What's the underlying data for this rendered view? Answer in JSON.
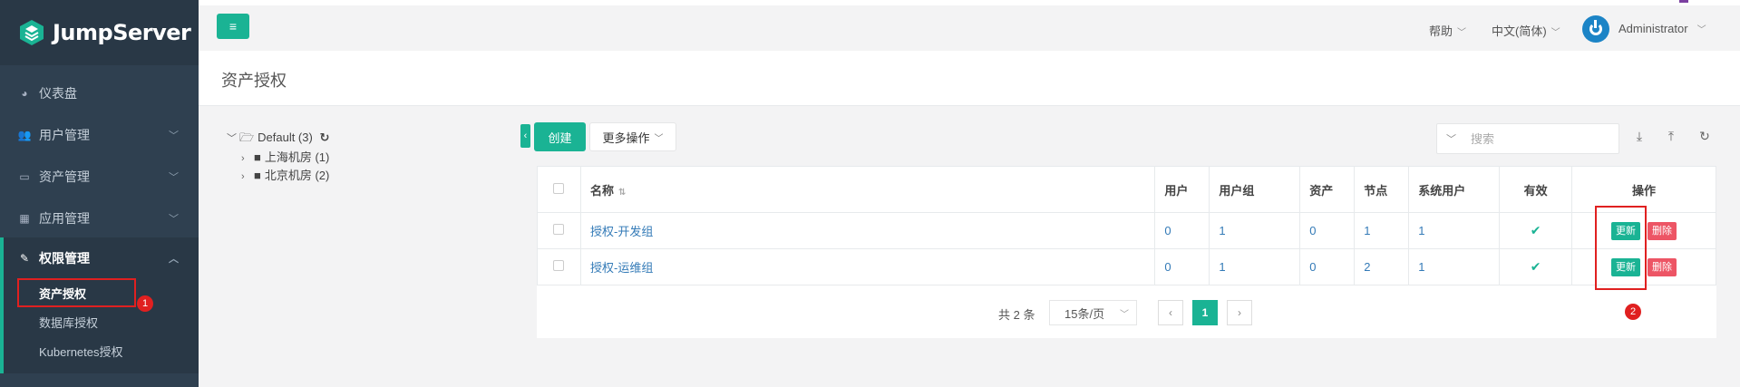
{
  "app": {
    "logo_text": "JumpServer"
  },
  "sidebar": {
    "items": [
      {
        "icon": "dashboard-icon",
        "label": "仪表盘"
      },
      {
        "icon": "users-icon",
        "label": "用户管理"
      },
      {
        "icon": "inbox-icon",
        "label": "资产管理"
      },
      {
        "icon": "grid-icon",
        "label": "应用管理"
      },
      {
        "icon": "edit-icon",
        "label": "权限管理"
      }
    ],
    "subitems": [
      "资产授权",
      "数据库授权",
      "Kubernetes授权"
    ]
  },
  "topbar": {
    "help": "帮助",
    "language": "中文(简体)",
    "user": "Administrator"
  },
  "page": {
    "title": "资产授权"
  },
  "tree": {
    "root": "Default (3)",
    "children": [
      "上海机房 (1)",
      "北京机房 (2)"
    ]
  },
  "toolbar": {
    "create": "创建",
    "more": "更多操作",
    "search_placeholder": "搜索"
  },
  "table": {
    "columns": [
      "名称",
      "用户",
      "用户组",
      "资产",
      "节点",
      "系统用户",
      "有效",
      "操作"
    ],
    "rows": [
      {
        "name": "授权-开发组",
        "users": "0",
        "groups": "1",
        "assets": "0",
        "nodes": "1",
        "sysusers": "1",
        "valid": "✔",
        "update": "更新",
        "delete": "删除"
      },
      {
        "name": "授权-运维组",
        "users": "0",
        "groups": "1",
        "assets": "0",
        "nodes": "2",
        "sysusers": "1",
        "valid": "✔",
        "update": "更新",
        "delete": "删除"
      }
    ]
  },
  "pager": {
    "total": "共 2 条",
    "page_size": "15条/页",
    "current": "1",
    "prev": "‹",
    "next": "›"
  },
  "annotations": {
    "one": "1",
    "two": "2"
  },
  "colors": {
    "accent": "#1ab394",
    "sidebar": "#2f4050",
    "danger": "#ed5565",
    "link": "#337ab7",
    "annotation": "#e02020"
  }
}
